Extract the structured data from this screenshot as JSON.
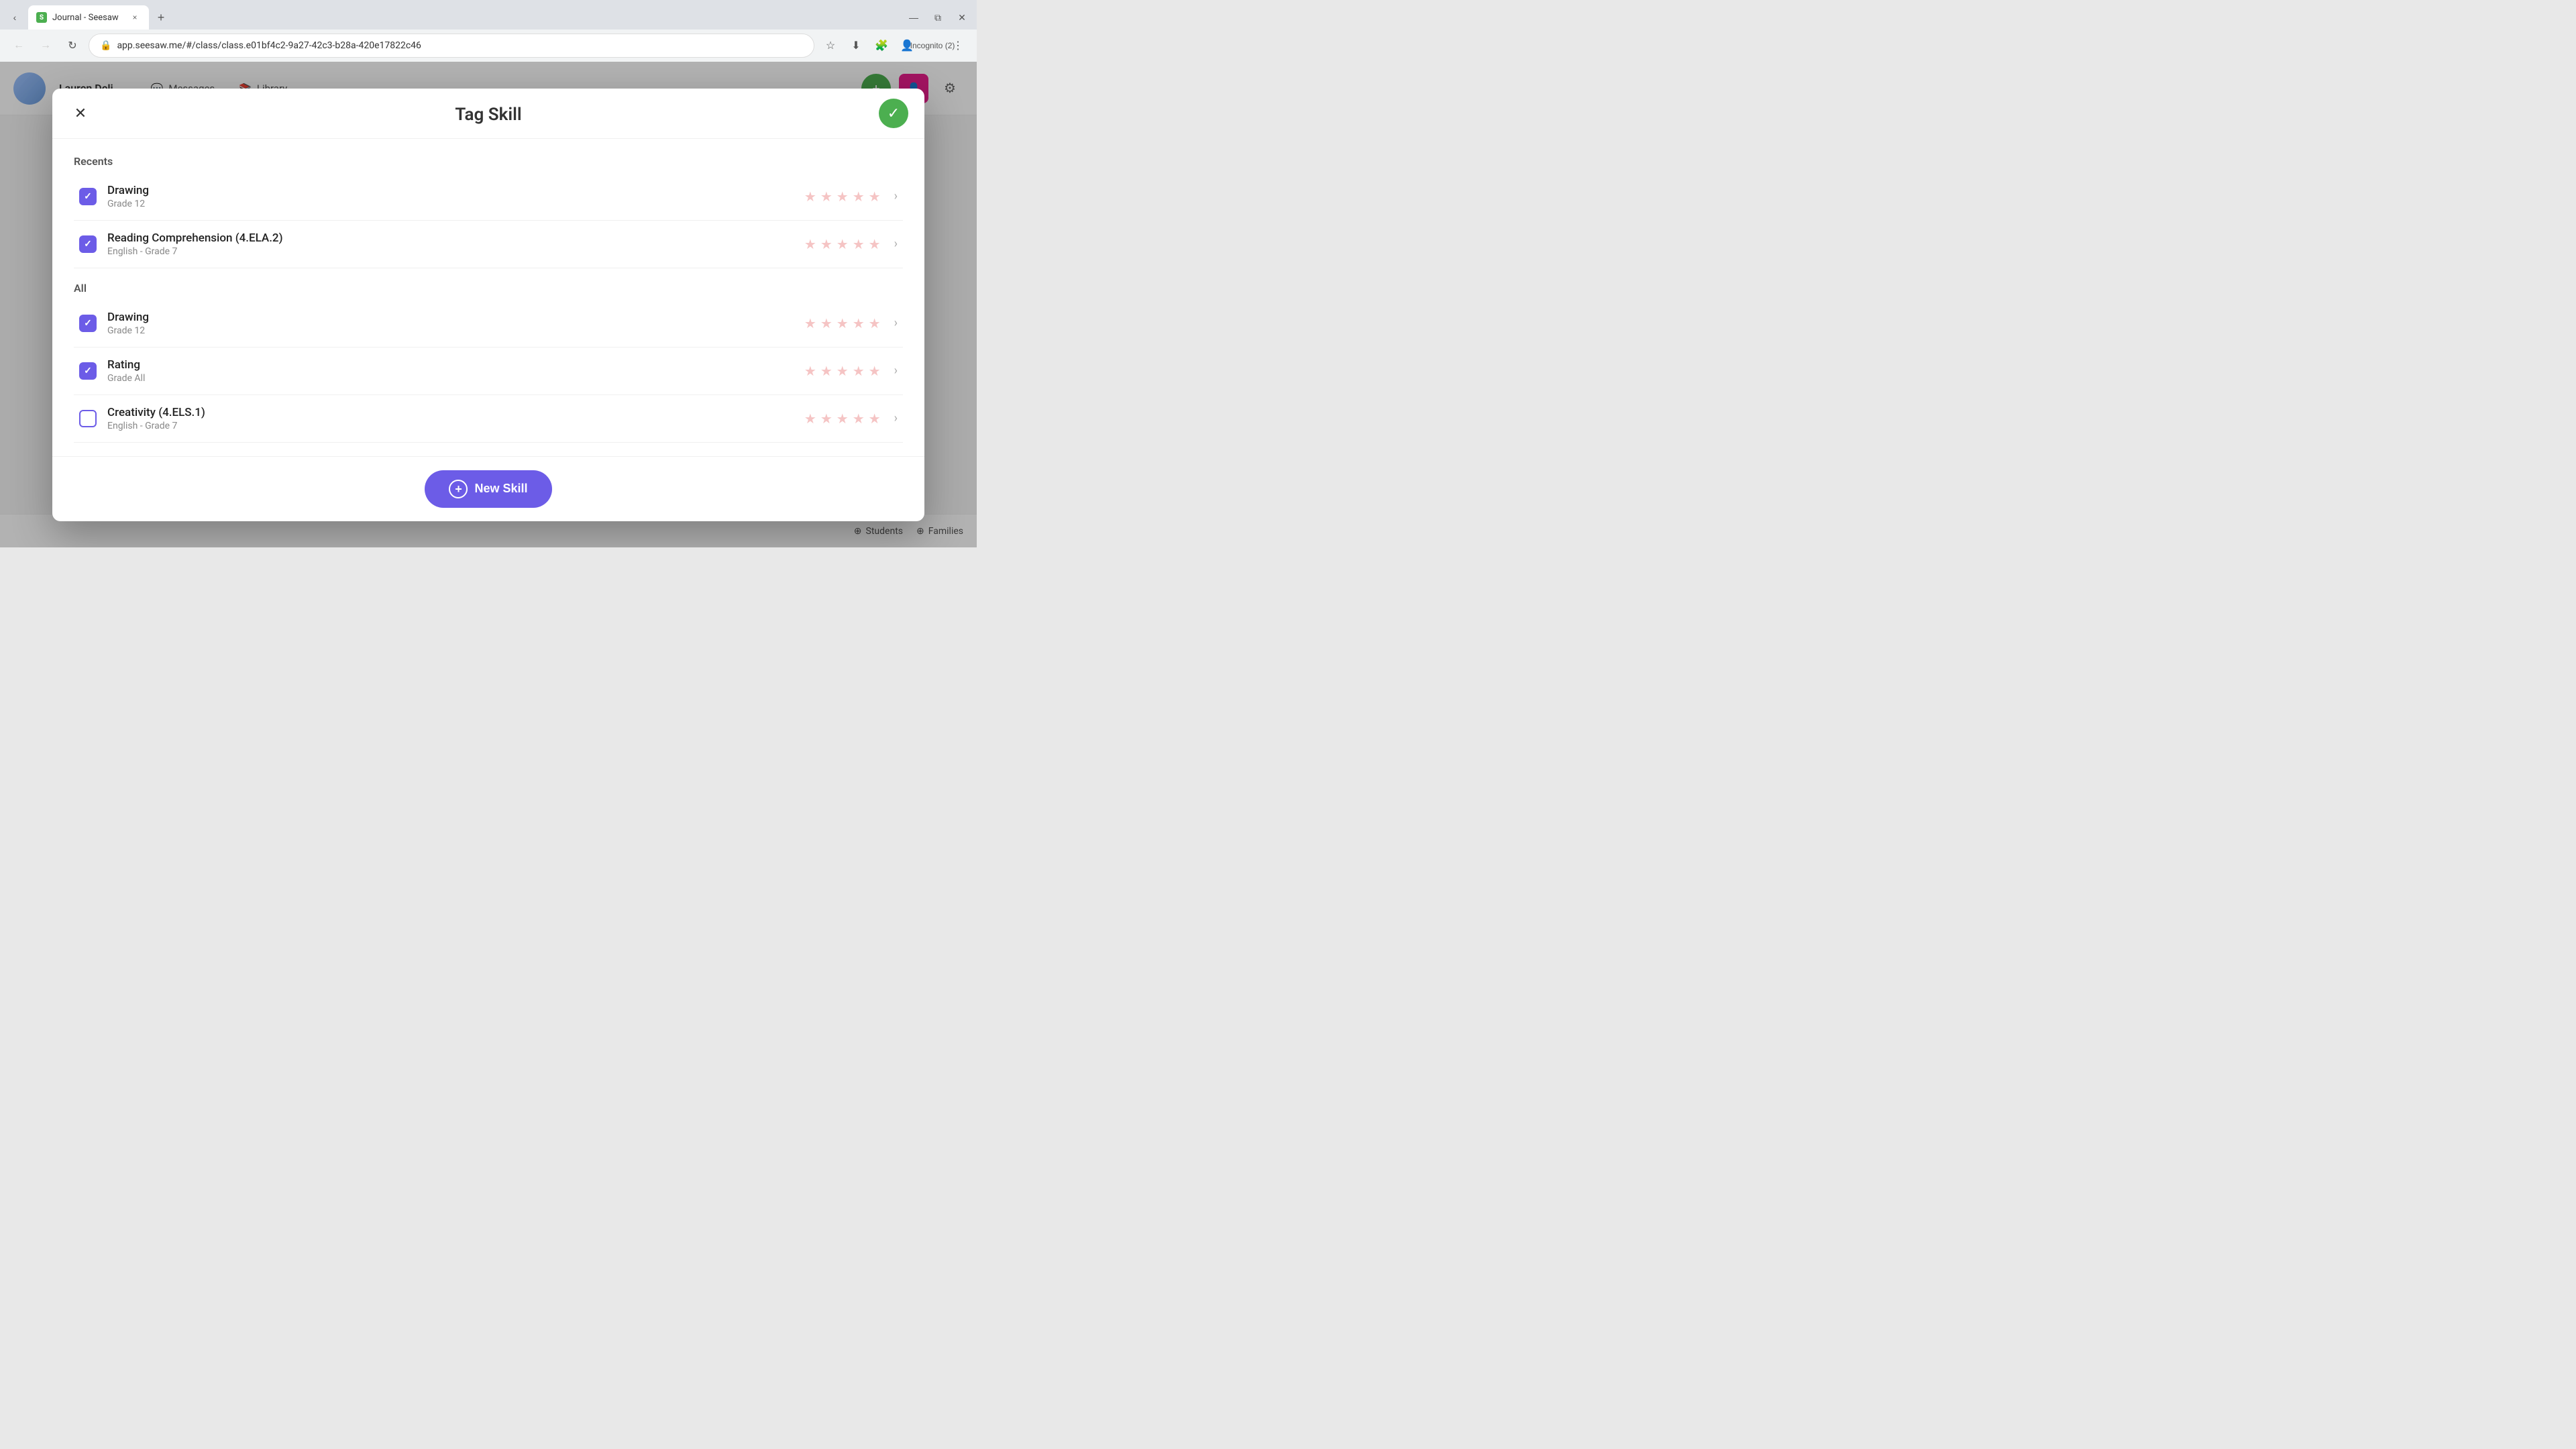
{
  "browser": {
    "tab_favicon": "S",
    "tab_title": "Journal - Seesaw",
    "tab_close_label": "×",
    "new_tab_label": "+",
    "win_minimize": "—",
    "win_maximize": "⧉",
    "win_close": "✕",
    "back_label": "←",
    "forward_label": "→",
    "refresh_label": "↻",
    "url": "app.seesaw.me/#/class/class.e01bf4c2-9a27-42c3-b28a-420e17822c46",
    "bookmark_label": "☆",
    "extensions_label": "🧩",
    "incognito_label": "Incognito (2)"
  },
  "app_header": {
    "user_name": "Lauren Deli",
    "nav_messages": "Messages",
    "nav_library": "Library"
  },
  "modal": {
    "title": "Tag Skill",
    "close_label": "✕",
    "confirm_checkmark": "✓",
    "sections": {
      "recents_label": "Recents",
      "all_label": "All"
    },
    "skills": {
      "recents": [
        {
          "id": "drawing-grade12",
          "name": "Drawing",
          "grade": "Grade 12",
          "checked": true,
          "stars": [
            1,
            1,
            1,
            1,
            1
          ]
        },
        {
          "id": "reading-comprehension",
          "name": "Reading Comprehension (4.ELA.2)",
          "grade": "English - Grade 7",
          "checked": true,
          "stars": [
            1,
            1,
            1,
            1,
            1
          ]
        }
      ],
      "all": [
        {
          "id": "drawing-all",
          "name": "Drawing",
          "grade": "Grade 12",
          "checked": true,
          "stars": [
            1,
            1,
            1,
            1,
            1
          ]
        },
        {
          "id": "rating-all",
          "name": "Rating",
          "grade": "Grade All",
          "checked": true,
          "stars": [
            1,
            1,
            1,
            1,
            1
          ]
        },
        {
          "id": "creativity-all",
          "name": "Creativity (4.ELS.1)",
          "grade": "English - Grade 7",
          "checked": false,
          "stars": [
            1,
            1,
            1,
            1,
            1
          ]
        }
      ]
    },
    "new_skill_button": "+ New Skill",
    "new_skill_plus": "+"
  },
  "bottom_bar": {
    "students_label": "Students",
    "families_label": "Families"
  }
}
